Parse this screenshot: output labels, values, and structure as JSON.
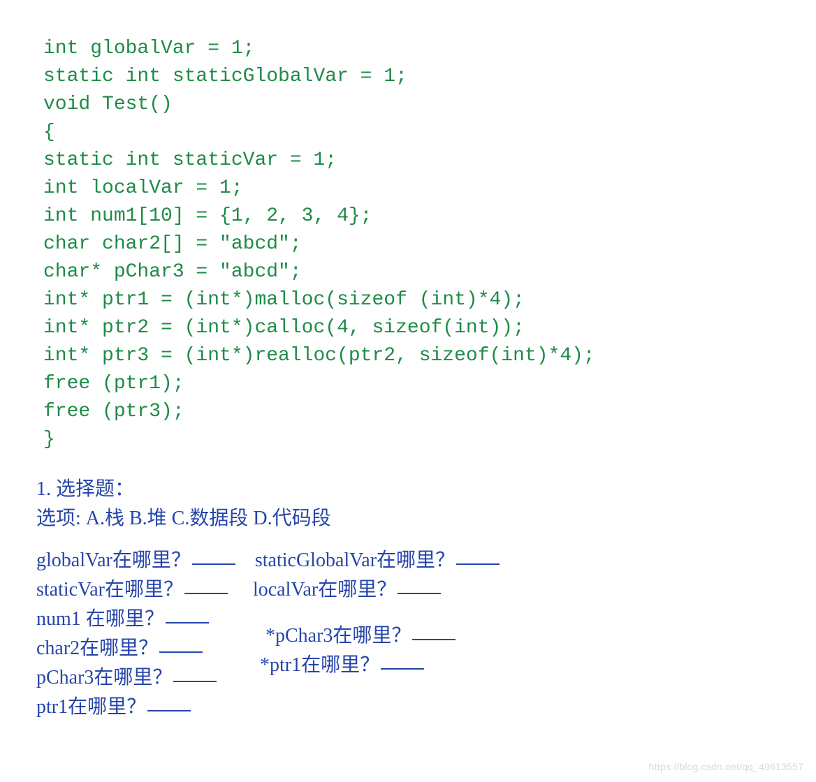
{
  "code": {
    "line1": "int globalVar = 1;",
    "line2": "static int staticGlobalVar = 1;",
    "line3": "void Test()",
    "line4": "{",
    "line5": "static int staticVar = 1;",
    "line6": "int localVar = 1;",
    "line7": "int num1[10] = {1, 2, 3, 4};",
    "line8": "char char2[] = \"abcd\";",
    "line9": "char* pChar3 = \"abcd\";",
    "line10": "int* ptr1 = (int*)malloc(sizeof (int)*4);",
    "line11": "int* ptr2 = (int*)calloc(4, sizeof(int));",
    "line12": "int* ptr3 = (int*)realloc(ptr2, sizeof(int)*4);",
    "line13": "free (ptr1);",
    "line14": "free (ptr3);",
    "line15": "}"
  },
  "quiz": {
    "title": "1. 选择题：",
    "options": "选项: A.栈  B.堆  C.数据段  D.代码段",
    "q1": "globalVar在哪里？",
    "q2": "staticGlobalVar在哪里？",
    "q3": "staticVar在哪里？",
    "q4": "localVar在哪里？",
    "q5": "num1 在哪里？",
    "q6": "char2在哪里？",
    "q7": "*pChar3在哪里？",
    "q8": "pChar3在哪里？",
    "q9": "*ptr1在哪里？",
    "q10": "ptr1在哪里？"
  },
  "watermark": "https://blog.csdn.net/qq_49613557"
}
